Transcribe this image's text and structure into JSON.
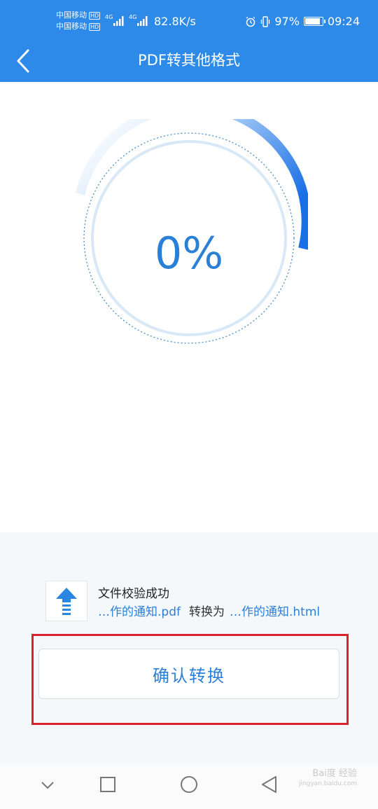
{
  "status_bar": {
    "carrier1": "中国移动",
    "carrier2": "中国移动",
    "hd": "HD",
    "network": "4G",
    "speed": "82.8K/s",
    "battery_pct": "97%",
    "battery_level": 0.97,
    "time": "09:24"
  },
  "header": {
    "title": "PDF转其他格式"
  },
  "progress": {
    "label": "0%",
    "value": 0
  },
  "file": {
    "status": "文件校验成功",
    "source": "…作的通知.pdf",
    "convert_to": "转换为",
    "target": "…作的通知.html"
  },
  "actions": {
    "confirm_label": "确认转换"
  },
  "watermark": {
    "line1": "Bai度 经验",
    "line2": "jingyan.baidu.com"
  },
  "colors": {
    "accent": "#2e8ae8",
    "text_blue": "#2a7fd6",
    "highlight": "#d92130"
  }
}
